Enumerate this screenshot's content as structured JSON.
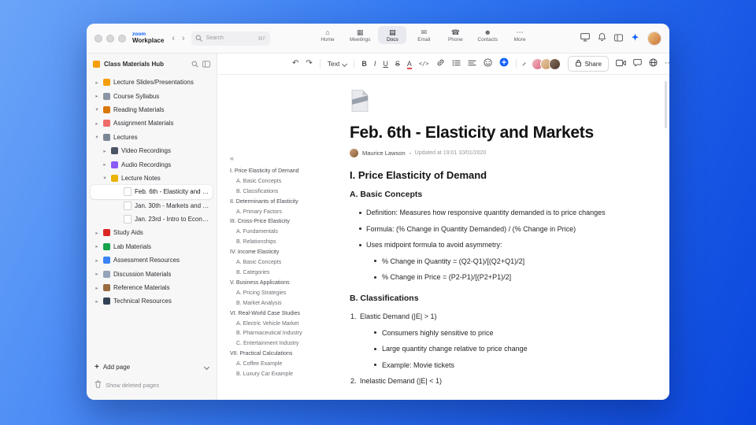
{
  "chrome": {
    "logo_primary": "zoom",
    "logo_secondary": "Workplace",
    "back_icon": "‹",
    "forward_icon": "›",
    "search": {
      "placeholder": "Search",
      "shortcut": "⌘F"
    },
    "tabs": [
      {
        "label": "Home",
        "icon": "⌂"
      },
      {
        "label": "Meetings",
        "icon": "▦"
      },
      {
        "label": "Docs",
        "icon": "▤"
      },
      {
        "label": "Email",
        "icon": "✉"
      },
      {
        "label": "Phone",
        "icon": "☎"
      },
      {
        "label": "Contacts",
        "icon": "☻"
      },
      {
        "label": "More",
        "icon": "⋯"
      }
    ]
  },
  "sidebar": {
    "title": "Class Materials Hub",
    "items": [
      {
        "label": "Lecture Slides/Presentations",
        "chevron": "▸"
      },
      {
        "label": "Course Syllabus",
        "chevron": "▸"
      },
      {
        "label": "Reading Materials",
        "chevron": "▾"
      },
      {
        "label": "Assignment Materials",
        "chevron": "▸"
      },
      {
        "label": "Lectures",
        "chevron": "▾"
      },
      {
        "label": "Video Recordings",
        "chevron": "▸"
      },
      {
        "label": "Audio Recordings",
        "chevron": "▸"
      },
      {
        "label": "Lecture Notes",
        "chevron": "▾"
      },
      {
        "label": "Feb. 6th - Elasticity and M...",
        "chevron": ""
      },
      {
        "label": "Jan. 30th - Markets and P...",
        "chevron": ""
      },
      {
        "label": "Jan. 23rd - Intro to Econo...",
        "chevron": ""
      },
      {
        "label": "Study Aids",
        "chevron": "▸"
      },
      {
        "label": "Lab Materials",
        "chevron": "▸"
      },
      {
        "label": "Assessment Resources",
        "chevron": "▸"
      },
      {
        "label": "Discussion Materials",
        "chevron": "▸"
      },
      {
        "label": "Reference Materials",
        "chevron": "▸"
      },
      {
        "label": "Technical Resources",
        "chevron": "▸"
      }
    ],
    "footer": {
      "add_icon": "+",
      "add_page": "Add page",
      "show_deleted": "Show deleted pages"
    }
  },
  "toolbar": {
    "undo_icon": "↶",
    "redo_icon": "↷",
    "text_style": "Text",
    "bold": "B",
    "italic": "I",
    "underline": "U",
    "strikethrough": "S",
    "text_color": "A",
    "code": "</>",
    "share_label": "Share",
    "more_icon": "⋯"
  },
  "document": {
    "title": "Feb. 6th - Elasticity and Markets",
    "author": "Maurice Lawson",
    "updated": "Updated at 19:01 10/01/2020",
    "outline_collapse_icon": "«",
    "outline": [
      {
        "text": "I. Price Elasticity of Demand",
        "level": 0
      },
      {
        "text": "A. Basic Concepts",
        "level": 1
      },
      {
        "text": "B. Classifications",
        "level": 1
      },
      {
        "text": "II. Determinants of Elasticity",
        "level": 0
      },
      {
        "text": "A. Primary Factors",
        "level": 1
      },
      {
        "text": "III. Cross-Price Elasticity",
        "level": 0
      },
      {
        "text": "A. Fundamentals",
        "level": 1
      },
      {
        "text": "B. Relationships",
        "level": 1
      },
      {
        "text": "IV. Income Elasticity",
        "level": 0
      },
      {
        "text": "A. Basic Concepts",
        "level": 1
      },
      {
        "text": "B. Categories",
        "level": 1
      },
      {
        "text": "V. Business Applications",
        "level": 0
      },
      {
        "text": "A. Pricing Strategies",
        "level": 1
      },
      {
        "text": "B. Market Analysis",
        "level": 1
      },
      {
        "text": "VI. Real-World Case Studies",
        "level": 0
      },
      {
        "text": "A. Electric Vehicle Market",
        "level": 1
      },
      {
        "text": "B. Pharmaceutical Industry",
        "level": 1
      },
      {
        "text": "C. Entertainment Industry",
        "level": 1
      },
      {
        "text": "VII. Practical Calculations",
        "level": 0
      },
      {
        "text": "A. Coffee Example",
        "level": 1
      },
      {
        "text": "B. Luxury Car Example",
        "level": 1
      }
    ],
    "body": [
      {
        "type": "h2",
        "text": "I. Price Elasticity of Demand"
      },
      {
        "type": "h3",
        "text": "A. Basic Concepts"
      },
      {
        "type": "bullet",
        "text": "Definition: Measures how responsive quantity demanded is to price changes"
      },
      {
        "type": "bullet",
        "text": "Formula: (% Change in Quantity Demanded) / (% Change in Price)"
      },
      {
        "type": "bullet",
        "text": "Uses midpoint formula to avoid asymmetry:"
      },
      {
        "type": "bullet2",
        "text": "% Change in Quantity = (Q2-Q1)/[(Q2+Q1)/2]"
      },
      {
        "type": "bullet2",
        "text": "% Change in Price = (P2-P1)/[(P2+P1)/2]"
      },
      {
        "type": "h3",
        "text": "B. Classifications"
      },
      {
        "type": "numbered",
        "marker": "1.",
        "text": "Elastic Demand (|E| > 1)"
      },
      {
        "type": "bullet2",
        "text": "Consumers highly sensitive to price"
      },
      {
        "type": "bullet2",
        "text": "Large quantity change relative to price change"
      },
      {
        "type": "bullet2",
        "text": "Example: Movie tickets"
      },
      {
        "type": "numbered",
        "marker": "2.",
        "text": "Inelastic Demand (|E| < 1)"
      }
    ]
  },
  "colors": {
    "accent": "#0b5cff"
  }
}
